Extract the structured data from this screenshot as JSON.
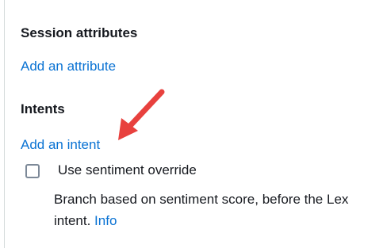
{
  "session_attributes": {
    "title": "Session attributes",
    "add_link": "Add an attribute"
  },
  "intents": {
    "title": "Intents",
    "add_link": "Add an intent"
  },
  "sentiment_override": {
    "label": "Use sentiment override",
    "checked": false,
    "description": "Branch based on sentiment score, before the Lex intent.",
    "info_link": "Info"
  },
  "annotation": {
    "arrow_color": "#e8413e"
  }
}
